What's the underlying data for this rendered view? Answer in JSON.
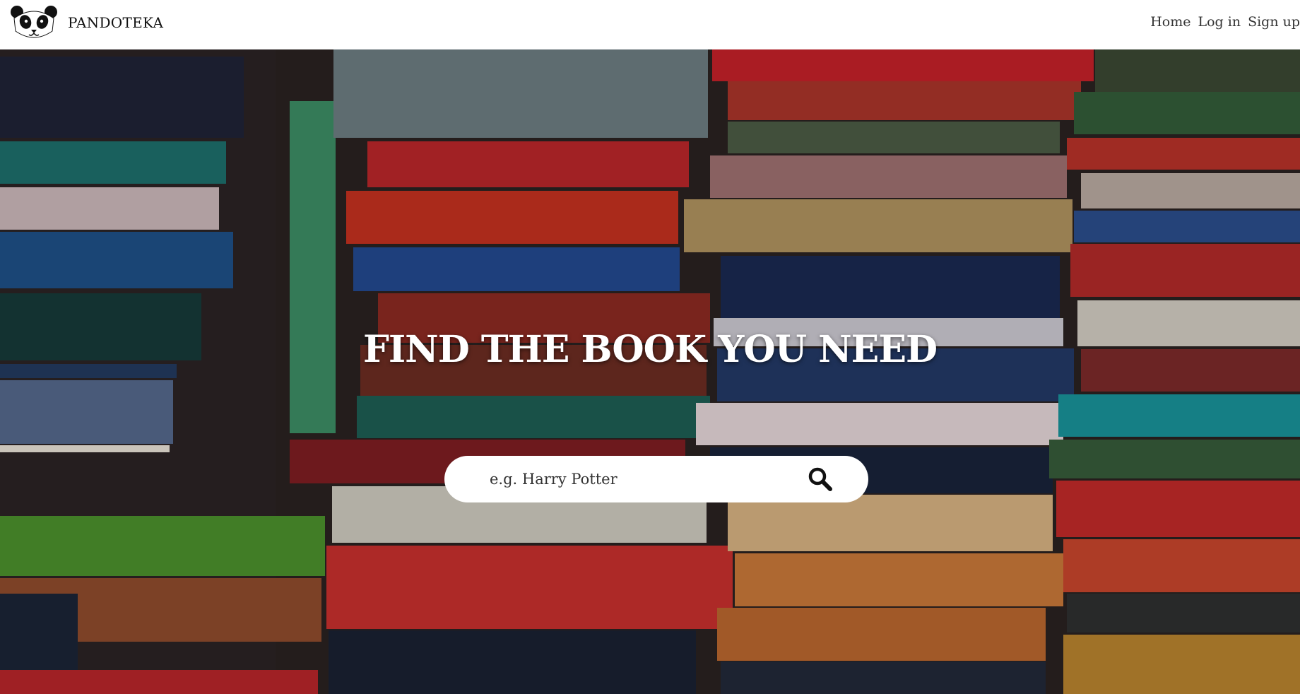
{
  "header": {
    "brand_name": "PANDOTEKA",
    "logo_icon": "panda-logo-icon",
    "nav": [
      {
        "label": "Home"
      },
      {
        "label": "Log in"
      },
      {
        "label": "Sign up"
      }
    ]
  },
  "hero": {
    "headline": "FIND THE BOOK YOU NEED",
    "search": {
      "placeholder": "e.g. Harry Potter",
      "value": "",
      "icon": "search-icon"
    },
    "background_icon": "bookshelf-photo"
  }
}
